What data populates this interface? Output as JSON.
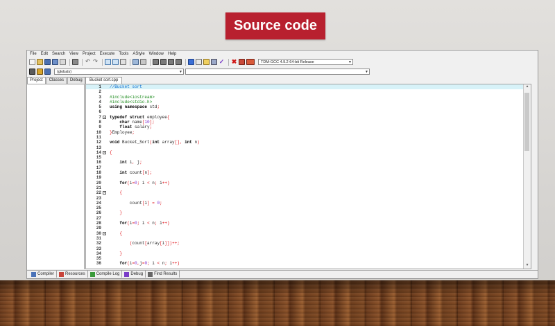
{
  "slide": {
    "title": "Source code"
  },
  "menu": [
    "File",
    "Edit",
    "Search",
    "View",
    "Project",
    "Execute",
    "Tools",
    "AStyle",
    "Window",
    "Help"
  ],
  "toolbar": {
    "compiler_select": "TDM-GCC 4.9.2 64-bit Release",
    "scope_select": "(globals)",
    "function_select": ""
  },
  "left_tabs": [
    "Project",
    "Classes",
    "Debug"
  ],
  "file_tab": "Bucket sort.cpp",
  "bottom_tabs": [
    {
      "label": "Compiler",
      "icon": "compiler-icon"
    },
    {
      "label": "Resources",
      "icon": "resources-icon"
    },
    {
      "label": "Compile Log",
      "icon": "compile-log-icon"
    },
    {
      "label": "Debug",
      "icon": "debug-icon"
    },
    {
      "label": "Find Results",
      "icon": "find-results-icon"
    }
  ],
  "colors": {
    "title_bg": "#b8202f",
    "line_highlight": "#d7f2f8",
    "preprocessor": "#1a8a1a",
    "comment": "#0a6fd1",
    "symbol": "#e0141a"
  },
  "code_lines": [
    {
      "n": "1",
      "text": "//Bucket sort",
      "fold": ""
    },
    {
      "n": "2",
      "text": "",
      "fold": ""
    },
    {
      "n": "3",
      "text": "#include<iostream>",
      "fold": ""
    },
    {
      "n": "4",
      "text": "#include<stdio.h>",
      "fold": ""
    },
    {
      "n": "5",
      "text": "using namespace std;",
      "fold": ""
    },
    {
      "n": "6",
      "text": "",
      "fold": ""
    },
    {
      "n": "7",
      "text": "typedef struct employee{",
      "fold": "-"
    },
    {
      "n": "8",
      "text": "    char name[10];",
      "fold": ""
    },
    {
      "n": "9",
      "text": "    float salary;",
      "fold": ""
    },
    {
      "n": "10",
      "text": "}Employee;",
      "fold": ""
    },
    {
      "n": "11",
      "text": "",
      "fold": ""
    },
    {
      "n": "12",
      "text": "void Bucket_Sort(int array[], int n)",
      "fold": ""
    },
    {
      "n": "13",
      "text": "",
      "fold": ""
    },
    {
      "n": "14",
      "text": "{",
      "fold": "-"
    },
    {
      "n": "15",
      "text": "",
      "fold": ""
    },
    {
      "n": "16",
      "text": "    int i, j;",
      "fold": ""
    },
    {
      "n": "17",
      "text": "",
      "fold": ""
    },
    {
      "n": "18",
      "text": "    int count[n];",
      "fold": ""
    },
    {
      "n": "19",
      "text": "",
      "fold": ""
    },
    {
      "n": "20",
      "text": "    for(i=0; i < n; i++)",
      "fold": ""
    },
    {
      "n": "21",
      "text": "",
      "fold": ""
    },
    {
      "n": "22",
      "text": "    {",
      "fold": "-"
    },
    {
      "n": "23",
      "text": "",
      "fold": ""
    },
    {
      "n": "24",
      "text": "        count[i] = 0;",
      "fold": ""
    },
    {
      "n": "25",
      "text": "",
      "fold": ""
    },
    {
      "n": "26",
      "text": "    }",
      "fold": ""
    },
    {
      "n": "27",
      "text": "",
      "fold": ""
    },
    {
      "n": "28",
      "text": "    for(i=0; i < n; i++)",
      "fold": ""
    },
    {
      "n": "29",
      "text": "",
      "fold": ""
    },
    {
      "n": "30",
      "text": "    {",
      "fold": "-"
    },
    {
      "n": "31",
      "text": "",
      "fold": ""
    },
    {
      "n": "32",
      "text": "        (count[array[i]])++;",
      "fold": ""
    },
    {
      "n": "33",
      "text": "",
      "fold": ""
    },
    {
      "n": "34",
      "text": "    }",
      "fold": ""
    },
    {
      "n": "35",
      "text": "",
      "fold": ""
    },
    {
      "n": "36",
      "text": "    for(i=0,j=0; i < n; i++)",
      "fold": ""
    }
  ]
}
